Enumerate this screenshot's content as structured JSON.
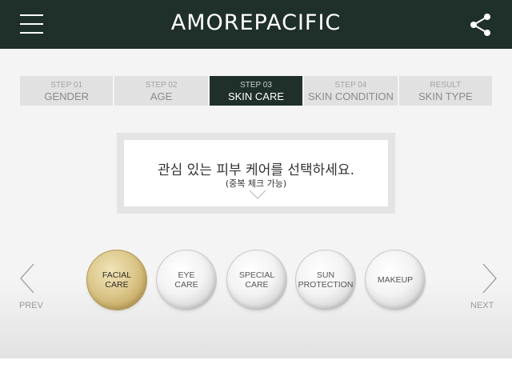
{
  "header": {
    "brand": "AMOREPACIFIC",
    "menu_icon": "hamburger-menu-icon",
    "share_icon": "share-icon",
    "background_color": "#1f302b"
  },
  "steps": [
    {
      "number": "STEP 01",
      "name": "GENDER",
      "active": false
    },
    {
      "number": "STEP 02",
      "name": "AGE",
      "active": false
    },
    {
      "number": "STEP 03",
      "name": "SKIN CARE",
      "active": true
    },
    {
      "number": "STEP 04",
      "name": "SKIN CONDITION",
      "active": false
    },
    {
      "number": "RESULT",
      "name": "SKIN TYPE",
      "active": false
    }
  ],
  "question": {
    "title": "관심 있는 피부 케어를 선택하세요.",
    "subtitle": "(중복 체크 가능)"
  },
  "nav": {
    "prev_label": "PREV",
    "next_label": "NEXT"
  },
  "options": [
    {
      "line1": "FACIAL",
      "line2": "CARE",
      "selected": true
    },
    {
      "line1": "EYE",
      "line2": "CARE",
      "selected": false
    },
    {
      "line1": "SPECIAL",
      "line2": "CARE",
      "selected": false
    },
    {
      "line1": "SUN",
      "line2": "PROTECTION",
      "selected": false
    },
    {
      "line1": "MAKEUP",
      "line2": "",
      "selected": false
    }
  ],
  "colors": {
    "accent_dark": "#1f302b",
    "selected_gold": "#dcc88c"
  }
}
